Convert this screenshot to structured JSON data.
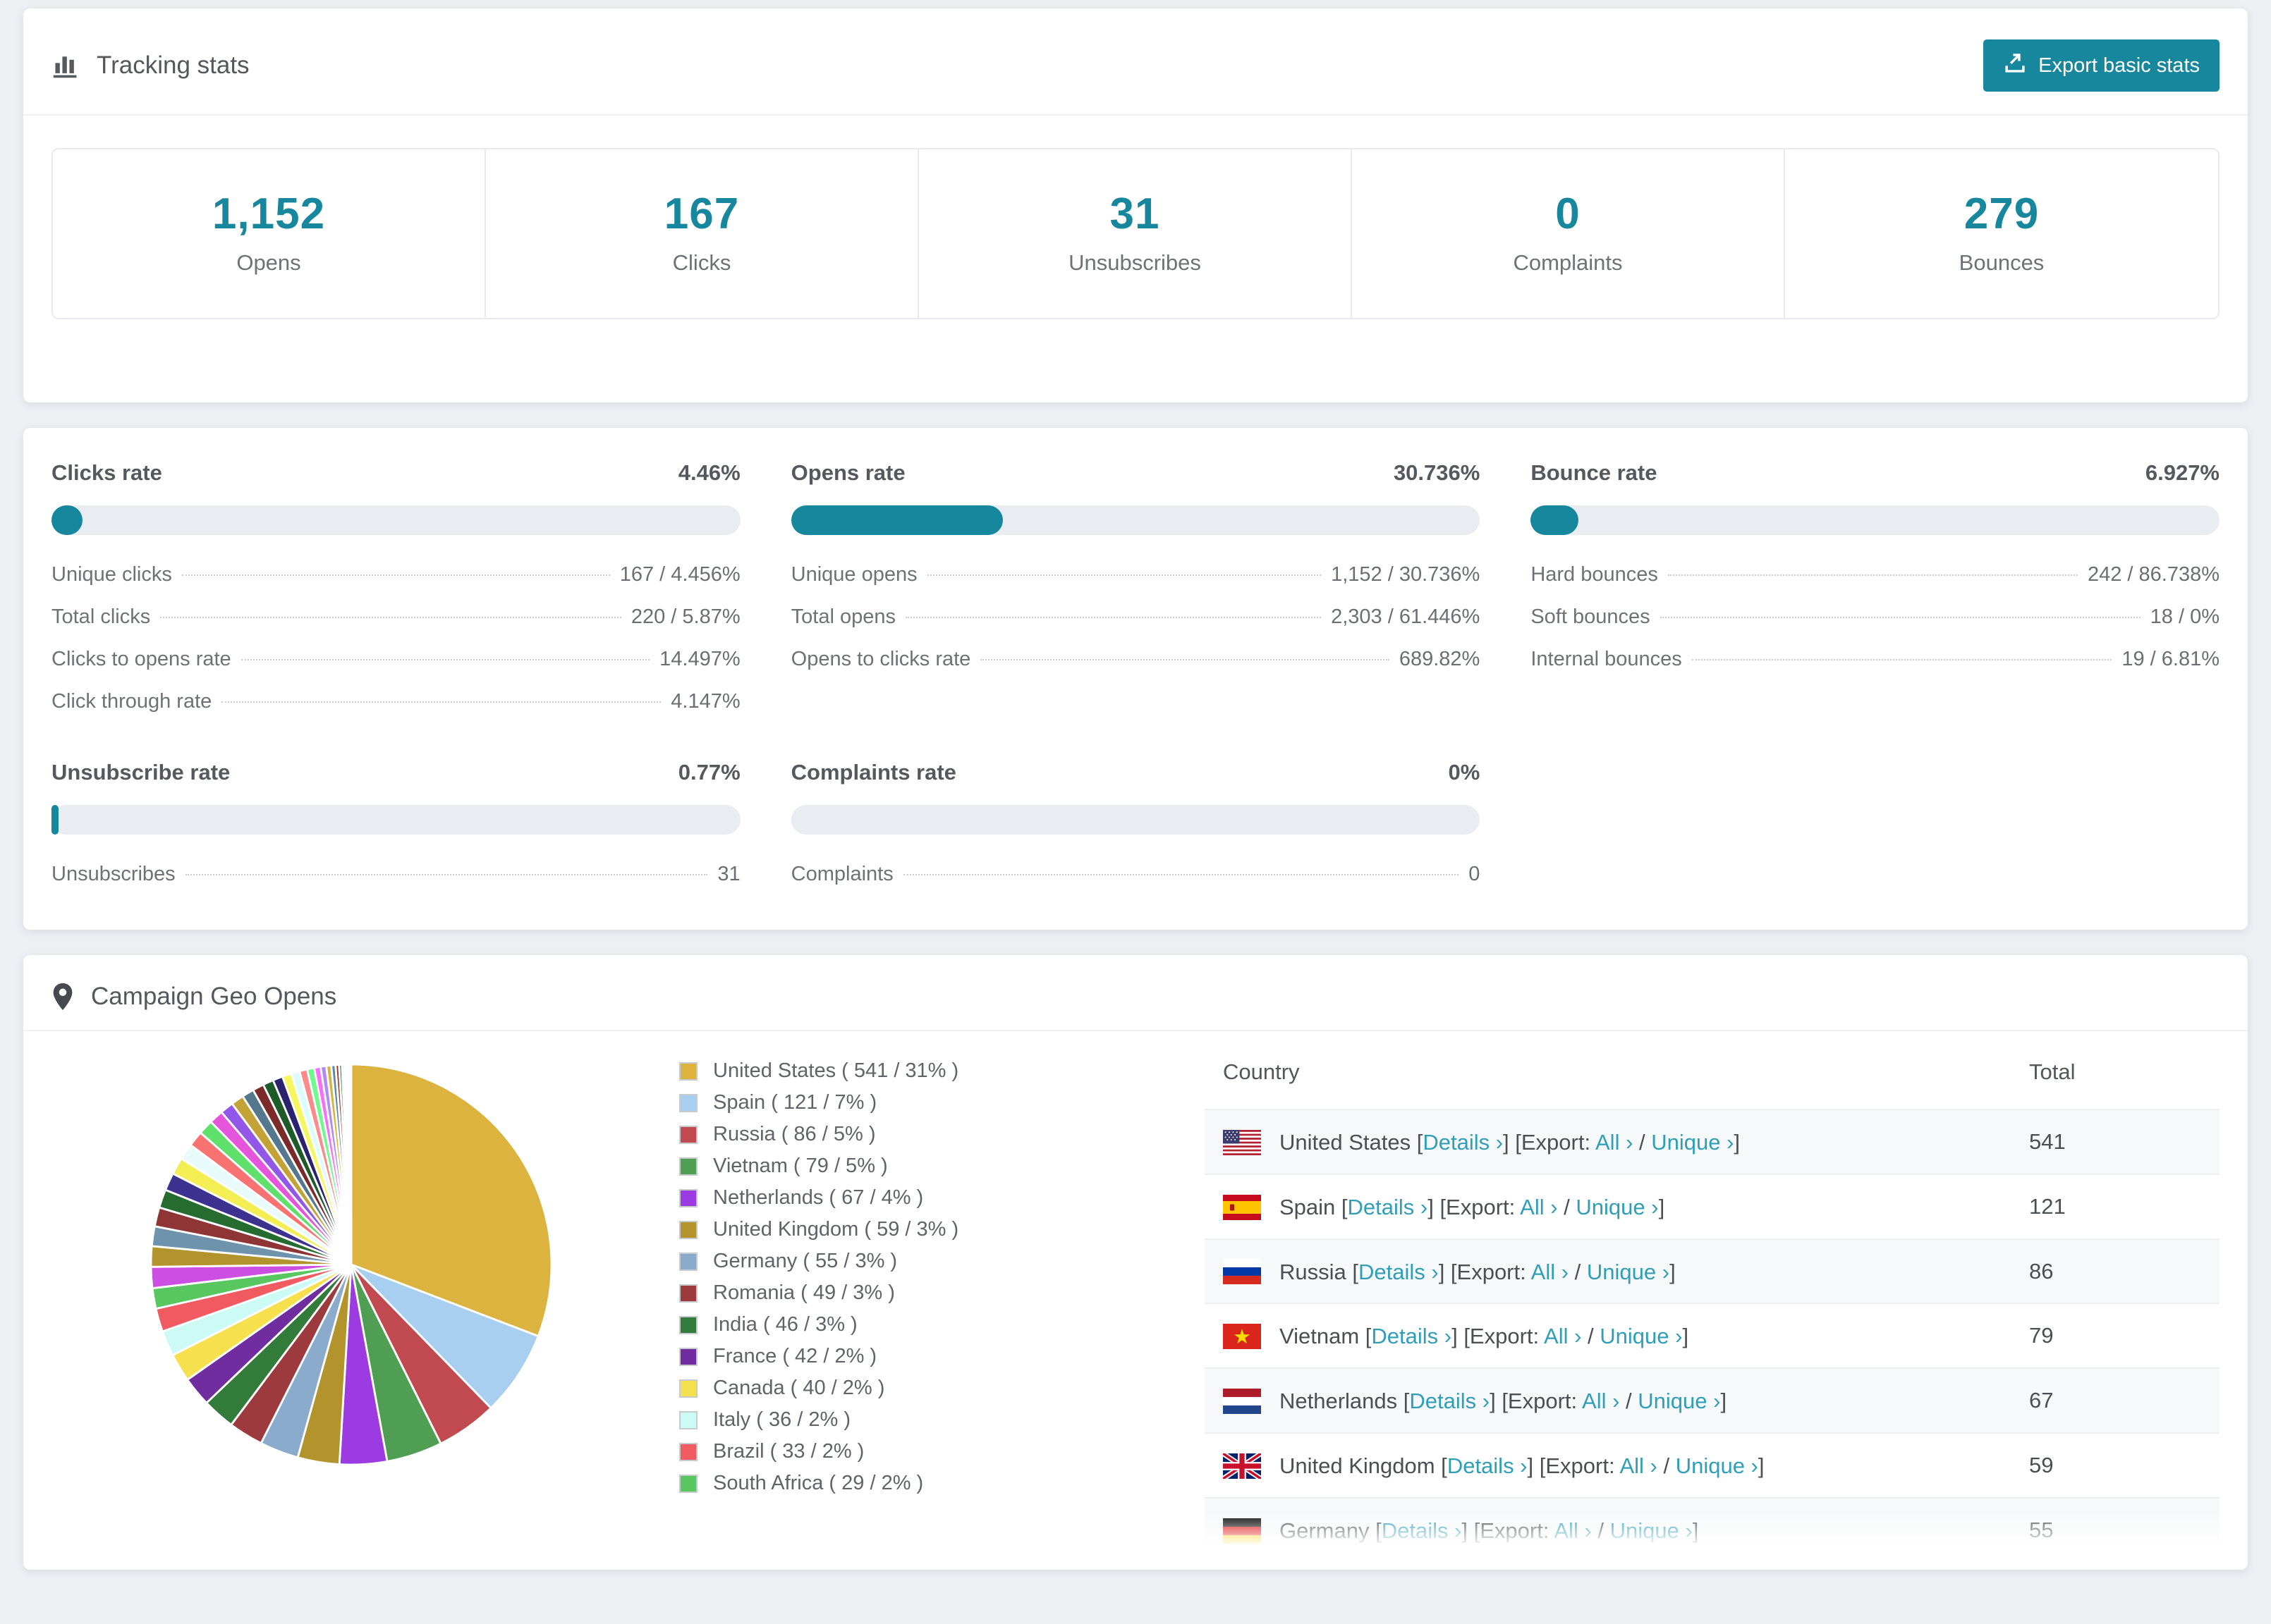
{
  "tracking": {
    "title": "Tracking stats",
    "export_button": "Export basic stats"
  },
  "summary_stats": [
    {
      "value": "1,152",
      "label": "Opens"
    },
    {
      "value": "167",
      "label": "Clicks"
    },
    {
      "value": "31",
      "label": "Unsubscribes"
    },
    {
      "value": "0",
      "label": "Complaints"
    },
    {
      "value": "279",
      "label": "Bounces"
    }
  ],
  "rates": [
    {
      "title": "Clicks rate",
      "pct_label": "4.46%",
      "bar_pct": 4.46,
      "rows": [
        {
          "label": "Unique clicks",
          "value": "167 / 4.456%"
        },
        {
          "label": "Total clicks",
          "value": "220 / 5.87%"
        },
        {
          "label": "Clicks to opens rate",
          "value": "14.497%"
        },
        {
          "label": "Click through rate",
          "value": "4.147%"
        }
      ]
    },
    {
      "title": "Opens rate",
      "pct_label": "30.736%",
      "bar_pct": 30.736,
      "rows": [
        {
          "label": "Unique opens",
          "value": "1,152 / 30.736%"
        },
        {
          "label": "Total opens",
          "value": "2,303 / 61.446%"
        },
        {
          "label": "Opens to clicks rate",
          "value": "689.82%"
        }
      ]
    },
    {
      "title": "Bounce rate",
      "pct_label": "6.927%",
      "bar_pct": 6.927,
      "rows": [
        {
          "label": "Hard bounces",
          "value": "242 / 86.738%"
        },
        {
          "label": "Soft bounces",
          "value": "18 / 0%"
        },
        {
          "label": "Internal bounces",
          "value": "19 / 6.81%"
        }
      ]
    },
    {
      "title": "Unsubscribe rate",
      "pct_label": "0.77%",
      "bar_pct": 0.77,
      "rows": [
        {
          "label": "Unsubscribes",
          "value": "31"
        }
      ]
    },
    {
      "title": "Complaints rate",
      "pct_label": "0%",
      "bar_pct": 0,
      "rows": [
        {
          "label": "Complaints",
          "value": "0"
        }
      ]
    }
  ],
  "geo": {
    "title": "Campaign Geo Opens",
    "columns": {
      "country": "Country",
      "total": "Total"
    },
    "link_labels": {
      "details": "Details ›",
      "export_label": "Export:",
      "all": "All ›",
      "unique": "Unique ›",
      "bracket_open": "[",
      "bracket_close": "]",
      "separator": "/"
    },
    "rows": [
      {
        "country": "United States",
        "flag": "us",
        "total": "541"
      },
      {
        "country": "Spain",
        "flag": "es",
        "total": "121"
      },
      {
        "country": "Russia",
        "flag": "ru",
        "total": "86"
      },
      {
        "country": "Vietnam",
        "flag": "vn",
        "total": "79"
      },
      {
        "country": "Netherlands",
        "flag": "nl",
        "total": "67"
      },
      {
        "country": "United Kingdom",
        "flag": "gb",
        "total": "59"
      },
      {
        "country": "Germany",
        "flag": "de",
        "total": "55"
      }
    ]
  },
  "chart_data": {
    "type": "pie",
    "title": "Campaign Geo Opens",
    "legend_position": "right",
    "start_angle_deg": 0,
    "direction": "clockwise",
    "total_estimated": 1745,
    "series": [
      {
        "label": "United States",
        "value": 541,
        "pct": "31%",
        "color": "#dcb33e"
      },
      {
        "label": "Spain",
        "value": 121,
        "pct": "7%",
        "color": "#a8cff0"
      },
      {
        "label": "Russia",
        "value": 86,
        "pct": "5%",
        "color": "#c04a50"
      },
      {
        "label": "Vietnam",
        "value": 79,
        "pct": "5%",
        "color": "#4f9e53"
      },
      {
        "label": "Netherlands",
        "value": 67,
        "pct": "4%",
        "color": "#9d3be3"
      },
      {
        "label": "United Kingdom",
        "value": 59,
        "pct": "3%",
        "color": "#b3932c"
      },
      {
        "label": "Germany",
        "value": 55,
        "pct": "3%",
        "color": "#8aabcc"
      },
      {
        "label": "Romania",
        "value": 49,
        "pct": "3%",
        "color": "#9c3a3e"
      },
      {
        "label": "India",
        "value": 46,
        "pct": "3%",
        "color": "#337b3b"
      },
      {
        "label": "France",
        "value": 42,
        "pct": "2%",
        "color": "#6f2da0"
      },
      {
        "label": "Canada",
        "value": 40,
        "pct": "2%",
        "color": "#f7e04e"
      },
      {
        "label": "Italy",
        "value": 36,
        "pct": "2%",
        "color": "#ccfaf5"
      },
      {
        "label": "Brazil",
        "value": 33,
        "pct": "2%",
        "color": "#f05a60"
      },
      {
        "label": "South Africa",
        "value": 29,
        "pct": "2%",
        "color": "#58c75f"
      }
    ],
    "others_unlabeled_segments": {
      "values": [
        30,
        29,
        28,
        27,
        26,
        25,
        24,
        23,
        22,
        21,
        20,
        19,
        18,
        17,
        16,
        15,
        14,
        13,
        12,
        11,
        10,
        9,
        8,
        7,
        6,
        5,
        4,
        3,
        3,
        2,
        2,
        1,
        1,
        1
      ],
      "colors": [
        "#cb4fe0",
        "#b3932c",
        "#6f93ad",
        "#8f3535",
        "#266b30",
        "#3f3190",
        "#f4ee55",
        "#e8fafa",
        "#f87272",
        "#5fe06b",
        "#e455dc",
        "#9257e8",
        "#c3a238",
        "#56788f",
        "#7c2b2b",
        "#1d5c28",
        "#2b2370",
        "#f6f65e",
        "#dcfcfc",
        "#fb8a8a",
        "#6ef98b",
        "#f96ef9",
        "#b288f9",
        "#d3b441",
        "#5f87a5",
        "#a03c32",
        "#27703a",
        "#3a2f85",
        "#f9f97a",
        "#e6fdfd",
        "#fba5a5",
        "#8bf9a5",
        "#f98bf9",
        "#b57dfc"
      ]
    }
  }
}
